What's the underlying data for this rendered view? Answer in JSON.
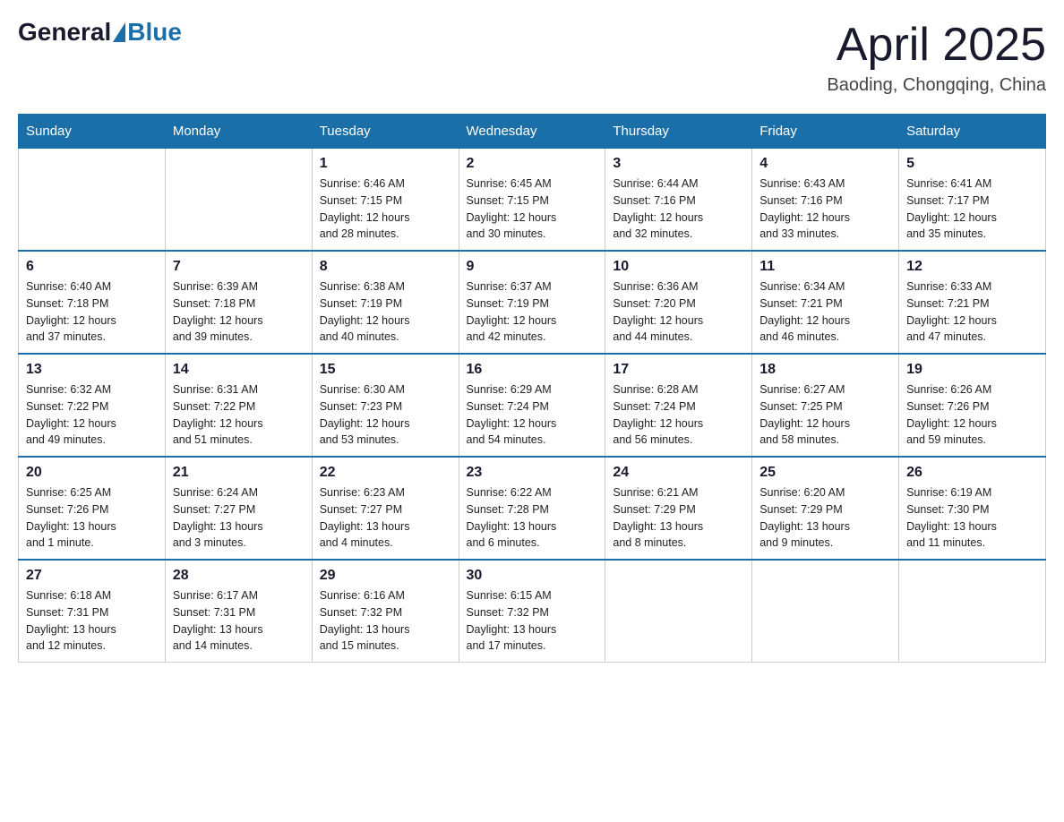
{
  "header": {
    "logo_general": "General",
    "logo_blue": "Blue",
    "month_title": "April 2025",
    "location": "Baoding, Chongqing, China"
  },
  "weekdays": [
    "Sunday",
    "Monday",
    "Tuesday",
    "Wednesday",
    "Thursday",
    "Friday",
    "Saturday"
  ],
  "weeks": [
    [
      {
        "day": "",
        "info": ""
      },
      {
        "day": "",
        "info": ""
      },
      {
        "day": "1",
        "info": "Sunrise: 6:46 AM\nSunset: 7:15 PM\nDaylight: 12 hours\nand 28 minutes."
      },
      {
        "day": "2",
        "info": "Sunrise: 6:45 AM\nSunset: 7:15 PM\nDaylight: 12 hours\nand 30 minutes."
      },
      {
        "day": "3",
        "info": "Sunrise: 6:44 AM\nSunset: 7:16 PM\nDaylight: 12 hours\nand 32 minutes."
      },
      {
        "day": "4",
        "info": "Sunrise: 6:43 AM\nSunset: 7:16 PM\nDaylight: 12 hours\nand 33 minutes."
      },
      {
        "day": "5",
        "info": "Sunrise: 6:41 AM\nSunset: 7:17 PM\nDaylight: 12 hours\nand 35 minutes."
      }
    ],
    [
      {
        "day": "6",
        "info": "Sunrise: 6:40 AM\nSunset: 7:18 PM\nDaylight: 12 hours\nand 37 minutes."
      },
      {
        "day": "7",
        "info": "Sunrise: 6:39 AM\nSunset: 7:18 PM\nDaylight: 12 hours\nand 39 minutes."
      },
      {
        "day": "8",
        "info": "Sunrise: 6:38 AM\nSunset: 7:19 PM\nDaylight: 12 hours\nand 40 minutes."
      },
      {
        "day": "9",
        "info": "Sunrise: 6:37 AM\nSunset: 7:19 PM\nDaylight: 12 hours\nand 42 minutes."
      },
      {
        "day": "10",
        "info": "Sunrise: 6:36 AM\nSunset: 7:20 PM\nDaylight: 12 hours\nand 44 minutes."
      },
      {
        "day": "11",
        "info": "Sunrise: 6:34 AM\nSunset: 7:21 PM\nDaylight: 12 hours\nand 46 minutes."
      },
      {
        "day": "12",
        "info": "Sunrise: 6:33 AM\nSunset: 7:21 PM\nDaylight: 12 hours\nand 47 minutes."
      }
    ],
    [
      {
        "day": "13",
        "info": "Sunrise: 6:32 AM\nSunset: 7:22 PM\nDaylight: 12 hours\nand 49 minutes."
      },
      {
        "day": "14",
        "info": "Sunrise: 6:31 AM\nSunset: 7:22 PM\nDaylight: 12 hours\nand 51 minutes."
      },
      {
        "day": "15",
        "info": "Sunrise: 6:30 AM\nSunset: 7:23 PM\nDaylight: 12 hours\nand 53 minutes."
      },
      {
        "day": "16",
        "info": "Sunrise: 6:29 AM\nSunset: 7:24 PM\nDaylight: 12 hours\nand 54 minutes."
      },
      {
        "day": "17",
        "info": "Sunrise: 6:28 AM\nSunset: 7:24 PM\nDaylight: 12 hours\nand 56 minutes."
      },
      {
        "day": "18",
        "info": "Sunrise: 6:27 AM\nSunset: 7:25 PM\nDaylight: 12 hours\nand 58 minutes."
      },
      {
        "day": "19",
        "info": "Sunrise: 6:26 AM\nSunset: 7:26 PM\nDaylight: 12 hours\nand 59 minutes."
      }
    ],
    [
      {
        "day": "20",
        "info": "Sunrise: 6:25 AM\nSunset: 7:26 PM\nDaylight: 13 hours\nand 1 minute."
      },
      {
        "day": "21",
        "info": "Sunrise: 6:24 AM\nSunset: 7:27 PM\nDaylight: 13 hours\nand 3 minutes."
      },
      {
        "day": "22",
        "info": "Sunrise: 6:23 AM\nSunset: 7:27 PM\nDaylight: 13 hours\nand 4 minutes."
      },
      {
        "day": "23",
        "info": "Sunrise: 6:22 AM\nSunset: 7:28 PM\nDaylight: 13 hours\nand 6 minutes."
      },
      {
        "day": "24",
        "info": "Sunrise: 6:21 AM\nSunset: 7:29 PM\nDaylight: 13 hours\nand 8 minutes."
      },
      {
        "day": "25",
        "info": "Sunrise: 6:20 AM\nSunset: 7:29 PM\nDaylight: 13 hours\nand 9 minutes."
      },
      {
        "day": "26",
        "info": "Sunrise: 6:19 AM\nSunset: 7:30 PM\nDaylight: 13 hours\nand 11 minutes."
      }
    ],
    [
      {
        "day": "27",
        "info": "Sunrise: 6:18 AM\nSunset: 7:31 PM\nDaylight: 13 hours\nand 12 minutes."
      },
      {
        "day": "28",
        "info": "Sunrise: 6:17 AM\nSunset: 7:31 PM\nDaylight: 13 hours\nand 14 minutes."
      },
      {
        "day": "29",
        "info": "Sunrise: 6:16 AM\nSunset: 7:32 PM\nDaylight: 13 hours\nand 15 minutes."
      },
      {
        "day": "30",
        "info": "Sunrise: 6:15 AM\nSunset: 7:32 PM\nDaylight: 13 hours\nand 17 minutes."
      },
      {
        "day": "",
        "info": ""
      },
      {
        "day": "",
        "info": ""
      },
      {
        "day": "",
        "info": ""
      }
    ]
  ]
}
